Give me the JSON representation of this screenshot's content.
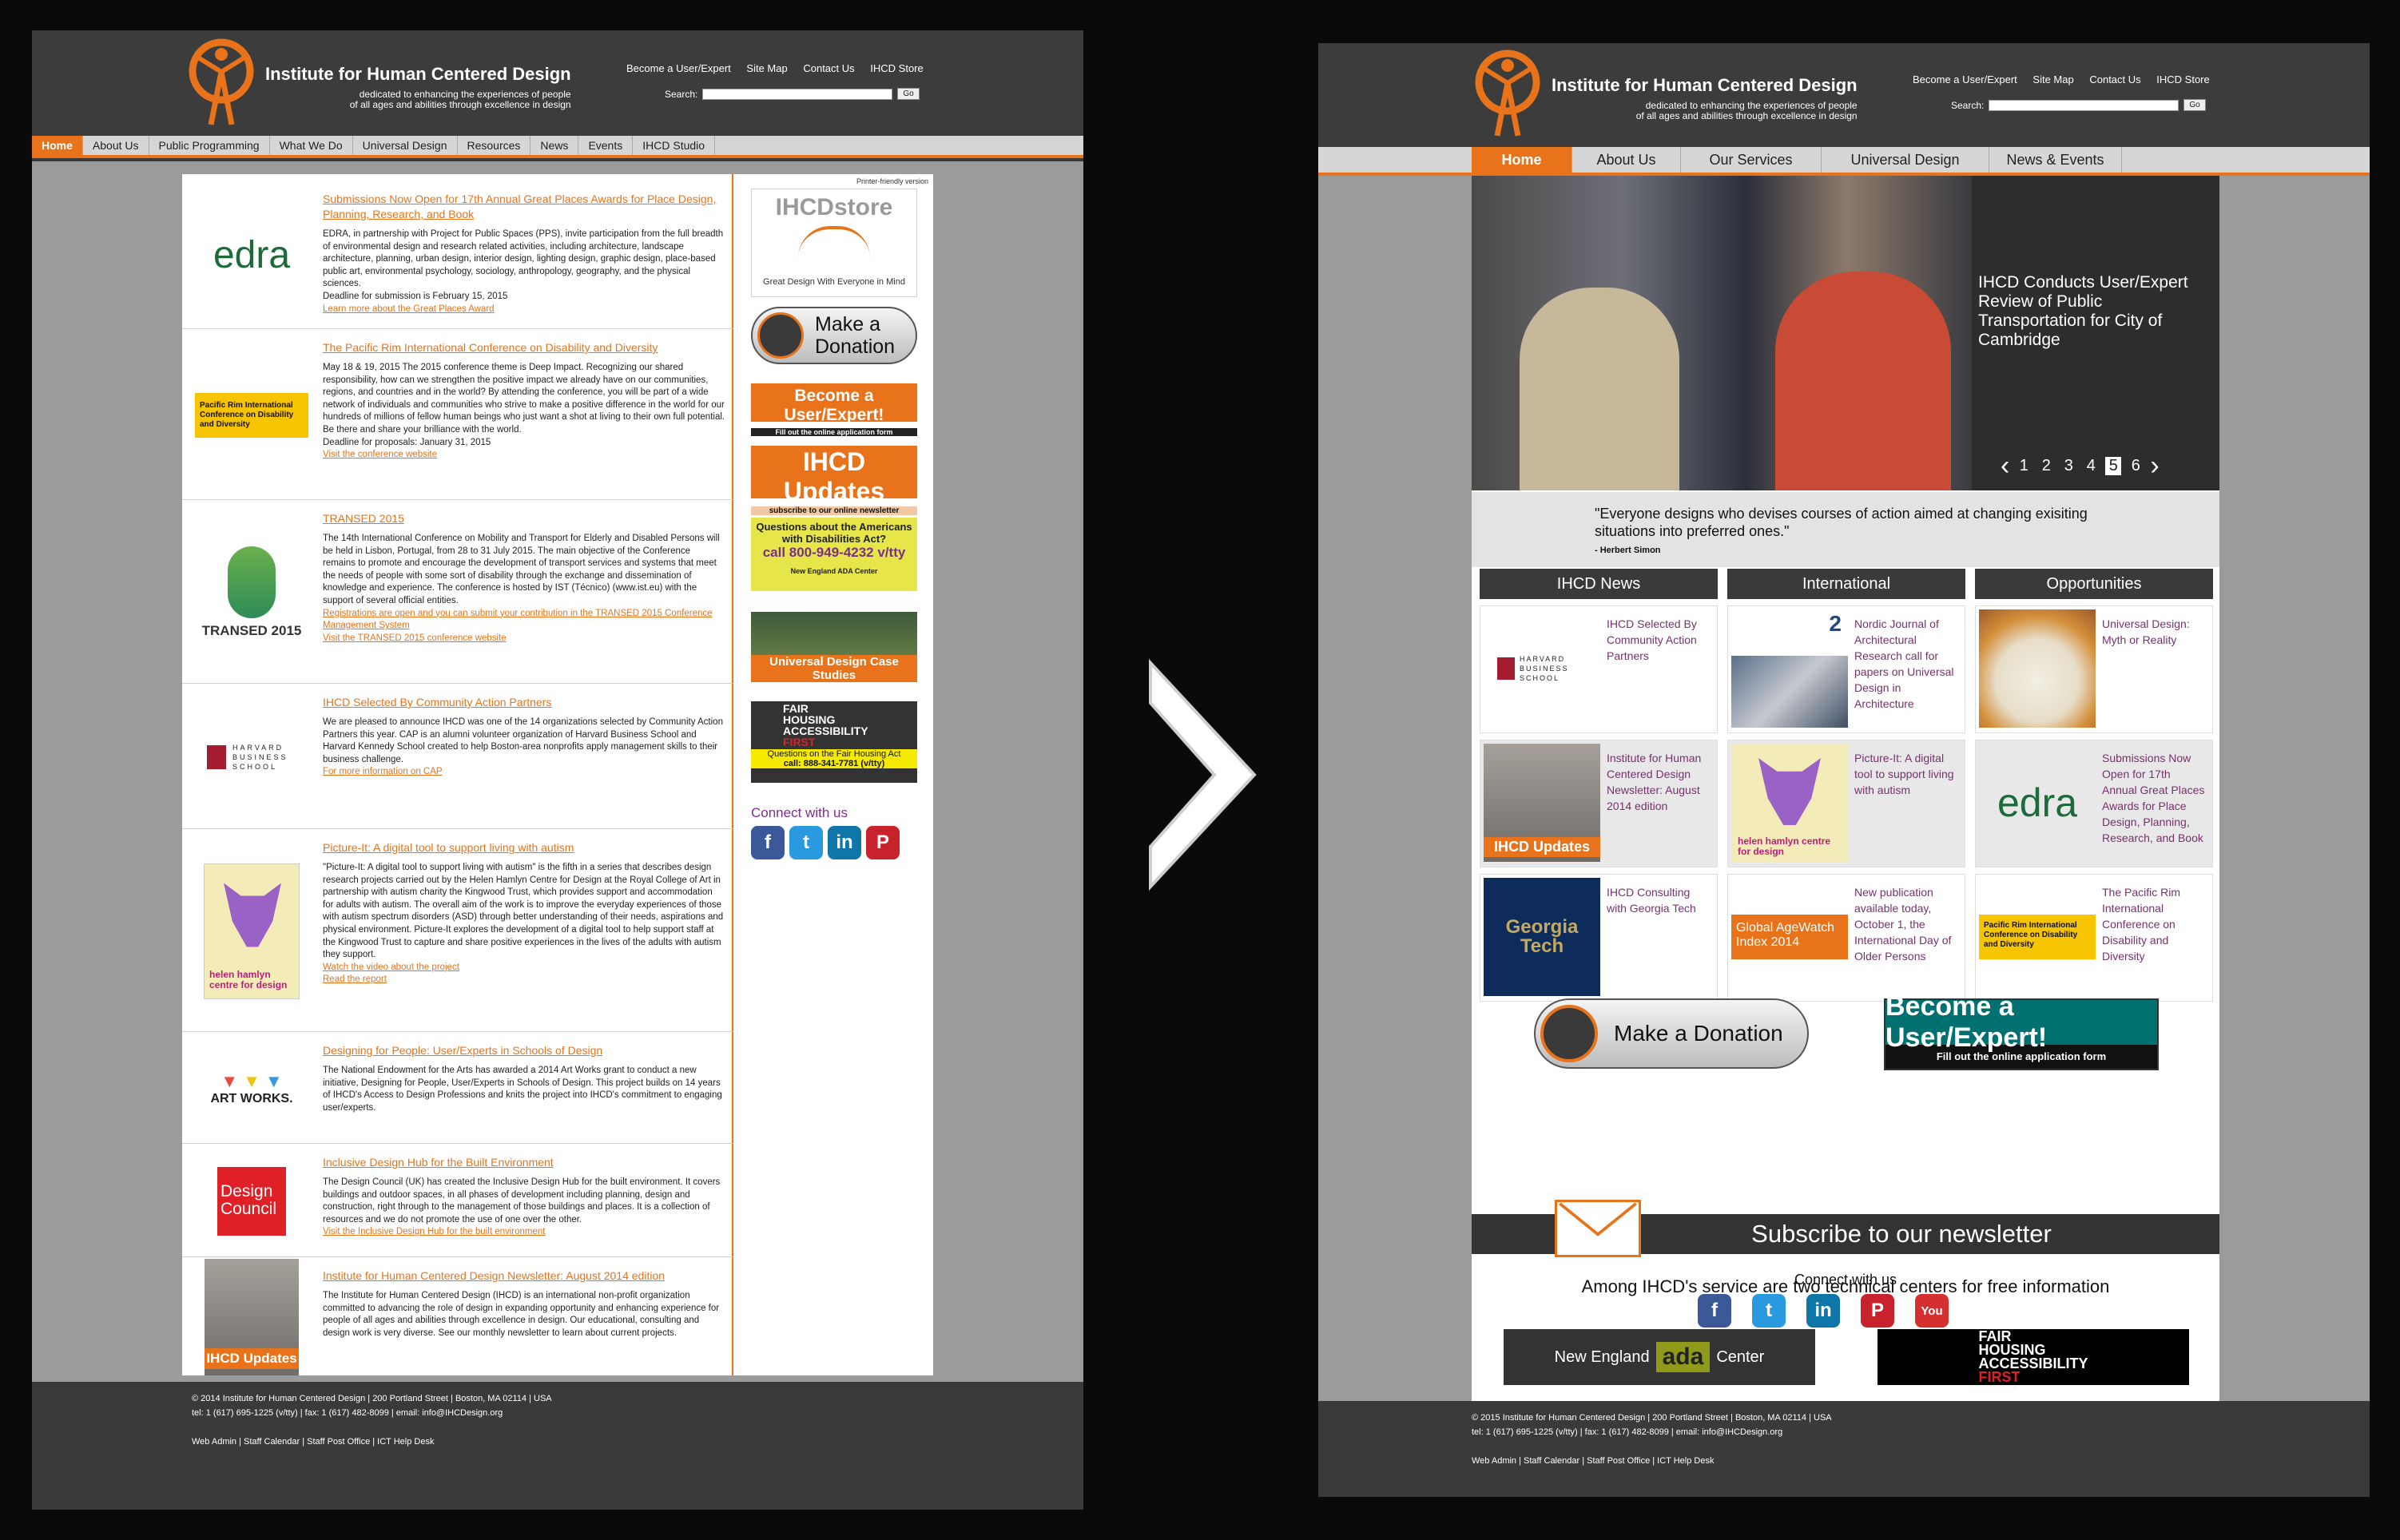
{
  "site": {
    "title": "Institute for Human Centered Design",
    "tagline_line1": "dedicated to enhancing the experiences of people",
    "tagline_line2": "of all ages and abilities through excellence in design",
    "top_links": [
      "Become a User/Expert",
      "Site Map",
      "Contact Us",
      "IHCD Store"
    ],
    "search_label": "Search:",
    "go_label": "Go",
    "accent": "#e8731a"
  },
  "old": {
    "nav": [
      "Home",
      "About Us",
      "Public Programming",
      "What We Do",
      "Universal Design",
      "Resources",
      "News",
      "Events",
      "IHCD Studio"
    ],
    "printer": "Printer-friendly version",
    "news": [
      {
        "logo": "edra",
        "title": "Submissions Now Open for 17th Annual Great Places Awards for Place Design, Planning, Research, and Book",
        "body": "EDRA, in partnership with Project for Public Spaces (PPS), invite participation from the full breadth of environmental design and research related activities, including architecture, landscape architecture, planning, urban design, interior design, lighting design, graphic design, place-based public art, environmental psychology, sociology, anthropology, geography, and the physical sciences.",
        "extra": "Deadline for submission is February 15, 2015",
        "link": "Learn more about the Great Places Award"
      },
      {
        "logo": "Pacific Rim International Conference on Disability and Diversity",
        "title": "The Pacific Rim International Conference on Disability and Diversity",
        "body": "May 18 & 19, 2015 The 2015 conference theme is Deep Impact. Recognizing our shared responsibility, how can we strengthen the positive impact we already have on our communities, regions, and countries and in the world? By attending the conference, you will be part of a wide network of individuals and communities who strive to make a positive difference in the world for our hundreds of millions of fellow human beings who just want a shot at living to their own full potential. Be there and share your brilliance with the world.",
        "extra": "Deadline for proposals: January 31, 2015",
        "link": "Visit the conference website"
      },
      {
        "logo": "TRANSED 2015",
        "title": "TRANSED 2015",
        "body": "The 14th International Conference on Mobility and Transport for Elderly and Disabled Persons will be held in Lisbon, Portugal, from 28 to 31 July 2015. The main objective of the Conference remains to promote and encourage the development of transport services and systems that meet the needs of people with some sort of disability through the exchange and dissemination of knowledge and experience. The conference is hosted by IST (Técnico) (www.ist.eu) with the support of several official entities.",
        "extra": "",
        "link": "Registrations are open and you can submit your contribution in the TRANSED 2015 Conference Management System",
        "link2": "Visit the TRANSED 2015 conference website"
      },
      {
        "logo": "HARVARD BUSINESS SCHOOL",
        "title": "IHCD Selected By Community Action Partners",
        "body": "We are pleased to announce IHCD was one of the 14 organizations selected by Community Action Partners this year. CAP is an alumni volunteer organization of Harvard Business School and Harvard Kennedy School created to help Boston-area nonprofits apply management skills to their business challenge.",
        "extra": "",
        "link": "For more information on CAP"
      },
      {
        "logo": "helen hamlyn centre for design",
        "title": "Picture-It: A digital tool to support living with autism",
        "body": "\"Picture-It: A digital tool to support living with autism\" is the fifth in a series that describes design research projects carried out by the Helen Hamlyn Centre for Design at the Royal College of Art in partnership with autism charity the Kingwood Trust, which provides support and accommodation for adults with autism. The overall aim of the work is to improve the everyday experiences of those with autism spectrum disorders (ASD) through better understanding of their needs, aspirations and physical environment. Picture-It explores the development of a digital tool to help support staff at the Kingwood Trust to capture and share positive experiences in the lives of the adults with autism they support.",
        "extra": "",
        "link": "Watch the video about the project",
        "link2": "Read the report"
      },
      {
        "logo": "ART WORKS.",
        "title": "Designing for People: User/Experts in Schools of Design",
        "body": "The National Endowment for the Arts has awarded a 2014 Art Works grant to conduct a new initiative, Designing for People, User/Experts in Schools of Design. This project builds on 14 years of IHCD's Access to Design Professions and knits the project into IHCD's commitment to engaging user/experts.",
        "extra": "",
        "link": ""
      },
      {
        "logo": "Design Council",
        "title": "Inclusive Design Hub for the Built Environment",
        "body": "The Design Council (UK) has created the Inclusive Design Hub for the built environment. It covers buildings and outdoor spaces, in all phases of development including planning, design and construction, right through to the management of those buildings and places. It is a collection of resources and we do not promote the use of one over the other.",
        "extra": "",
        "link": "Visit the Inclusive Design Hub for the built environment"
      },
      {
        "logo": "IHCD Updates",
        "title": "Institute for Human Centered Design Newsletter: August 2014 edition",
        "body": "The Institute for Human Centered Design (IHCD) is an international non-profit organization committed to advancing the role of design in expanding opportunity and enhancing experience for people of all ages and abilities through excellence in design. Our educational, consulting and design work is very diverse. See our monthly newsletter to learn about current projects.",
        "extra": "",
        "link": ""
      }
    ],
    "sidebar": {
      "store_title": "IHCDstore",
      "store_tag": "Great Design With Everyone in Mind",
      "donate": "Make a Donation",
      "become": "Become a User/Expert!",
      "become_sub": "Fill out the online application form",
      "updates": "IHCD Updates",
      "updates_sub": "subscribe to our online newsletter",
      "ada_q": "Questions about the Americans with Disabilities Act?",
      "ada_phone": "call 800-949-4232 v/tty",
      "ada_center": "New England ADA Center",
      "case": "Universal Design Case Studies",
      "fair1": "FAIR",
      "fair2": "HOUSING",
      "fair3": "ACCESSIBILITY",
      "fair4": "FIRST",
      "fair_q": "Questions on the Fair Housing Act",
      "fair_phone": "call: 888-341-7781 (v/tty)",
      "connect": "Connect with us"
    },
    "footer": {
      "line1": "© 2014 Institute for Human Centered Design | 200 Portland Street | Boston, MA 02114 | USA",
      "line2": "tel: 1 (617) 695-1225 (v/tty) | fax: 1 (617) 482-8099 | email: info@IHCDesign.org",
      "line3": "Web Admin | Staff Calendar | Staff Post Office | ICT Help Desk"
    }
  },
  "new": {
    "nav": [
      "Home",
      "About Us",
      "Our Services",
      "Universal Design",
      "News & Events"
    ],
    "hero_caption": "IHCD Conducts User/Expert Review of Public Transportation for City of Cambridge",
    "pager": [
      "1",
      "2",
      "3",
      "4",
      "5",
      "6"
    ],
    "pager_active": "5",
    "quote": "\"Everyone designs who devises courses of action aimed at changing exisiting situations into preferred ones.\"",
    "quote_author": "- Herbert Simon",
    "columns": [
      {
        "head": "IHCD News",
        "items": [
          {
            "img": "HARVARD BUSINESS SCHOOL",
            "text": "IHCD Selected By Community Action Partners"
          },
          {
            "img": "IHCD Updates",
            "text": "Institute for Human Centered Design Newsletter: August 2014 edition"
          },
          {
            "img": "Georgia Tech",
            "text": "IHCD Consulting with Georgia Tech"
          }
        ]
      },
      {
        "head": "International",
        "items": [
          {
            "img": "2",
            "text": "Nordic Journal of Architectural Research call for papers on Universal Design in Architecture"
          },
          {
            "img": "helen hamlyn centre for design",
            "text": "Picture-It: A digital tool to support living with autism"
          },
          {
            "img": "Global AgeWatch Index 2014",
            "text": "New publication available today, October 1, the International Day of Older Persons"
          }
        ]
      },
      {
        "head": "Opportunities",
        "items": [
          {
            "img": "",
            "text": "Universal Design: Myth or Reality"
          },
          {
            "img": "edra",
            "text": "Submissions Now Open for 17th Annual Great Places Awards for Place Design, Planning, Research, and Book"
          },
          {
            "img": "Pacific Rim International Conference on Disability and Diversity",
            "text": "The Pacific Rim International Conference on Disability and Diversity"
          }
        ]
      }
    ],
    "donate": "Make a Donation",
    "become": "Become a User/Expert!",
    "become_sub": "Fill out the online application form",
    "subscribe": "Subscribe to our newsletter",
    "among": "Among IHCD's service are two technical centers for free information",
    "ne_left": "New England",
    "ne_mid": "ada",
    "ne_right": "Center",
    "fair1": "FAIR",
    "fair2": "HOUSING",
    "fair3": "ACCESSIBILITY",
    "fair4": "FIRST",
    "connect": "Connect with us",
    "footer": {
      "line1": "© 2015 Institute for Human Centered Design | 200 Portland Street | Boston, MA 02114 | USA",
      "line2": "tel: 1 (617) 695-1225 (v/tty) | fax: 1 (617) 482-8099 | email: info@IHCDesign.org",
      "line3": "Web Admin | Staff Calendar | Staff Post Office | ICT Help Desk"
    }
  },
  "icons": {
    "arrow": "chevron-right-icon"
  }
}
